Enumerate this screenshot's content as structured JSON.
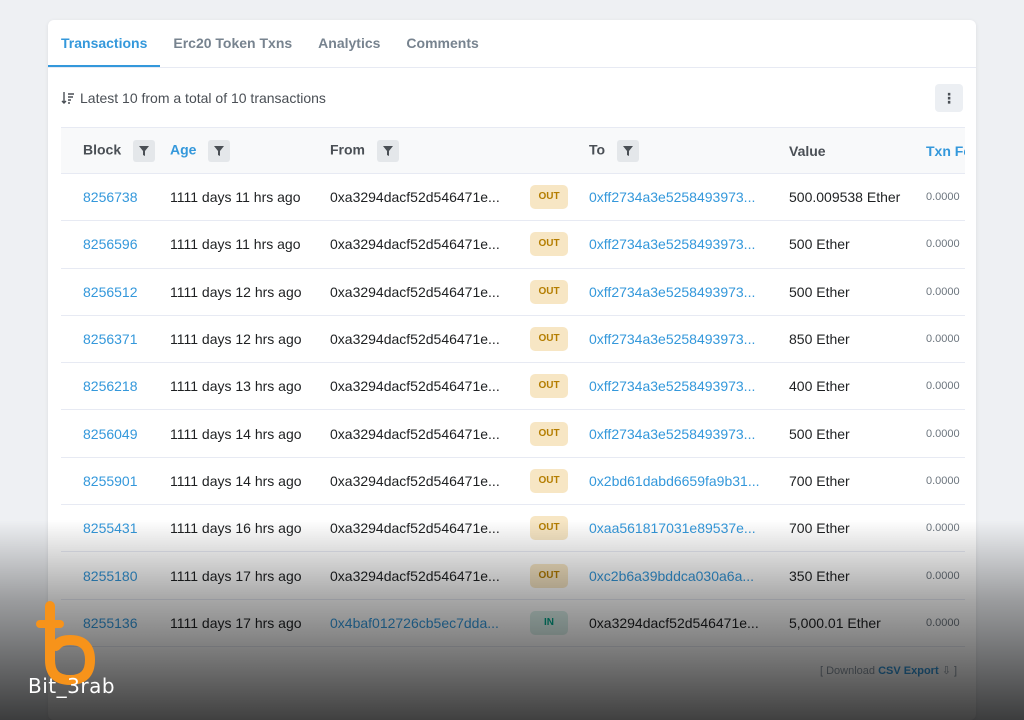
{
  "tabs": [
    {
      "label": "Transactions",
      "active": true
    },
    {
      "label": "Erc20 Token Txns",
      "active": false
    },
    {
      "label": "Analytics",
      "active": false
    },
    {
      "label": "Comments",
      "active": false
    }
  ],
  "summary": "Latest 10 from a total of 10 transactions",
  "more_button": "⋮",
  "columns": {
    "block": "Block",
    "age": "Age",
    "from": "From",
    "to": "To",
    "value": "Value",
    "fee": "Txn Fee"
  },
  "rows": [
    {
      "block": "8256738",
      "age": "1111 days 11 hrs ago",
      "from": "0xa3294dacf52d546471e...",
      "dir": "OUT",
      "to": "0xff2734a3e5258493973...",
      "value": "500.009538 Ether",
      "fee": "0.0000"
    },
    {
      "block": "8256596",
      "age": "1111 days 11 hrs ago",
      "from": "0xa3294dacf52d546471e...",
      "dir": "OUT",
      "to": "0xff2734a3e5258493973...",
      "value": "500 Ether",
      "fee": "0.0000"
    },
    {
      "block": "8256512",
      "age": "1111 days 12 hrs ago",
      "from": "0xa3294dacf52d546471e...",
      "dir": "OUT",
      "to": "0xff2734a3e5258493973...",
      "value": "500 Ether",
      "fee": "0.0000"
    },
    {
      "block": "8256371",
      "age": "1111 days 12 hrs ago",
      "from": "0xa3294dacf52d546471e...",
      "dir": "OUT",
      "to": "0xff2734a3e5258493973...",
      "value": "850 Ether",
      "fee": "0.0000"
    },
    {
      "block": "8256218",
      "age": "1111 days 13 hrs ago",
      "from": "0xa3294dacf52d546471e...",
      "dir": "OUT",
      "to": "0xff2734a3e5258493973...",
      "value": "400 Ether",
      "fee": "0.0000"
    },
    {
      "block": "8256049",
      "age": "1111 days 14 hrs ago",
      "from": "0xa3294dacf52d546471e...",
      "dir": "OUT",
      "to": "0xff2734a3e5258493973...",
      "value": "500 Ether",
      "fee": "0.0000"
    },
    {
      "block": "8255901",
      "age": "1111 days 14 hrs ago",
      "from": "0xa3294dacf52d546471e...",
      "dir": "OUT",
      "to": "0x2bd61dabd6659fa9b31...",
      "value": "700 Ether",
      "fee": "0.0000"
    },
    {
      "block": "8255431",
      "age": "1111 days 16 hrs ago",
      "from": "0xa3294dacf52d546471e...",
      "dir": "OUT",
      "to": "0xaa561817031e89537e...",
      "value": "700 Ether",
      "fee": "0.0000"
    },
    {
      "block": "8255180",
      "age": "1111 days 17 hrs ago",
      "from": "0xa3294dacf52d546471e...",
      "dir": "OUT",
      "to": "0xc2b6a39bddca030a6a...",
      "value": "350 Ether",
      "fee": "0.0000"
    },
    {
      "block": "8255136",
      "age": "1111 days 17 hrs ago",
      "from": "0x4baf012726cb5ec7dda...",
      "dir": "IN",
      "to": "0xa3294dacf52d546471e...",
      "value": "5,000.01 Ether",
      "fee": "0.0000"
    }
  ],
  "footer": {
    "prefix": "[ Download",
    "link": "CSV Export",
    "suffix": "⇩ ]"
  },
  "watermark": "Bit_3rab",
  "colors": {
    "accent": "#3498db",
    "out_badge": "#f7e6c4",
    "in_badge": "#d8eee8",
    "logo": "#f7931a"
  }
}
